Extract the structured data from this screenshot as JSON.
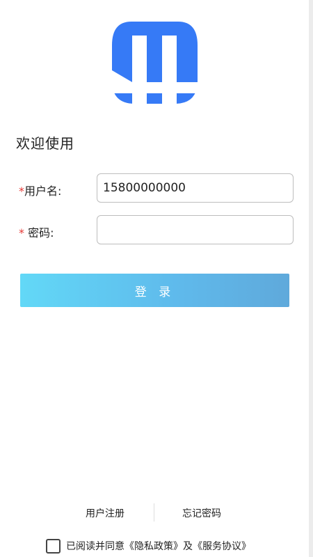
{
  "colors": {
    "logo_blue": "#367AF6",
    "required_star": "#E53935",
    "button_gradient_start": "#62D8F7",
    "button_gradient_end": "#5FA9DB",
    "button_text": "#FFFFFF"
  },
  "logo": {
    "icon": "app-logo-h-icon"
  },
  "welcome": "欢迎使用",
  "form": {
    "username": {
      "required_mark": "*",
      "label": "用户名:",
      "value": "15800000000",
      "placeholder": ""
    },
    "password": {
      "required_mark": "*",
      "label": " 密码:",
      "value": "",
      "placeholder": ""
    }
  },
  "login_button": "登 录",
  "links": {
    "register": "用户注册",
    "forgot_password": "忘记密码"
  },
  "agreement": {
    "checked": false,
    "prefix": "已阅读并同意",
    "privacy": "《隐私政策》",
    "and": "及",
    "terms": "《服务协议》"
  }
}
